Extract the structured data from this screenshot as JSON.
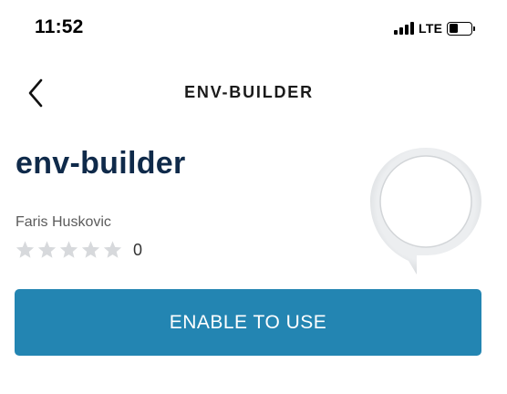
{
  "status_bar": {
    "time": "11:52",
    "network": "LTE",
    "signal_icon": "cellular-signal-icon",
    "battery_icon": "battery-icon"
  },
  "header": {
    "back_icon": "chevron-left-icon",
    "title": "ENV-BUILDER"
  },
  "skill": {
    "name": "env-builder",
    "author": "Faris Huskovic",
    "rating": {
      "stars_filled": 0,
      "stars_total": 5,
      "count": "0"
    },
    "icon": "alexa-speech-bubble-icon"
  },
  "actions": {
    "enable_label": "ENABLE TO USE"
  },
  "colors": {
    "button": "#2385b2",
    "title": "#0f2a4a",
    "star_empty": "#d7d9dc",
    "icon_ring": "#e3e5e7"
  }
}
